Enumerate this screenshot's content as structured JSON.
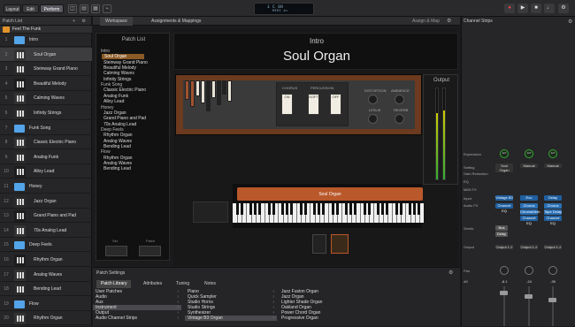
{
  "toolbar": {
    "layout_label": "Layout",
    "edit_label": "Edit",
    "perform_label": "Perform",
    "lcd_line1": "1  C  80",
    "lcd_line2": "MIDI in"
  },
  "left_panel": {
    "title": "Patch List",
    "rows": [
      {
        "num": "",
        "label": "Feel The Funk",
        "type": "set"
      },
      {
        "num": "1",
        "label": "Intro",
        "type": "folder"
      },
      {
        "num": "2",
        "label": "Soul Organ",
        "type": "patch",
        "selected": true
      },
      {
        "num": "3",
        "label": "Steinway Grand Piano",
        "type": "patch"
      },
      {
        "num": "4",
        "label": "Beautiful Melody",
        "type": "patch"
      },
      {
        "num": "5",
        "label": "Calming Waves",
        "type": "patch"
      },
      {
        "num": "6",
        "label": "Infinity Strings",
        "type": "patch"
      },
      {
        "num": "7",
        "label": "Funk Song",
        "type": "folder"
      },
      {
        "num": "8",
        "label": "Classic Electric Piano",
        "type": "patch"
      },
      {
        "num": "9",
        "label": "Analog Funk",
        "type": "patch"
      },
      {
        "num": "10",
        "label": "Alloy Lead",
        "type": "patch"
      },
      {
        "num": "11",
        "label": "Honey",
        "type": "folder"
      },
      {
        "num": "12",
        "label": "Jazz Organ",
        "type": "patch"
      },
      {
        "num": "13",
        "label": "Grand Piano and Pad",
        "type": "patch"
      },
      {
        "num": "14",
        "label": "70s Analog Lead",
        "type": "patch"
      },
      {
        "num": "15",
        "label": "Deep Feels",
        "type": "folder"
      },
      {
        "num": "16",
        "label": "Rhythm Organ",
        "type": "patch"
      },
      {
        "num": "17",
        "label": "Analog Waves",
        "type": "patch"
      },
      {
        "num": "18",
        "label": "Bending Lead",
        "type": "patch"
      },
      {
        "num": "19",
        "label": "Flow",
        "type": "folder"
      },
      {
        "num": "20",
        "label": "Rhythm Organ",
        "type": "patch"
      }
    ]
  },
  "tabs": {
    "workspace": "Workspace",
    "assignments": "Assignments & Mappings",
    "assign_map": "Assign & Map"
  },
  "patch_list_widget": {
    "title": "Patch List",
    "items": [
      {
        "label": "Intro",
        "kind": "head"
      },
      {
        "label": "Soul Organ",
        "kind": "sel"
      },
      {
        "label": "Steinway Grand Piano",
        "kind": "item"
      },
      {
        "label": "Beautiful Melody",
        "kind": "item"
      },
      {
        "label": "Calming Waves",
        "kind": "item"
      },
      {
        "label": "Infinity Strings",
        "kind": "item"
      },
      {
        "label": "Funk Song",
        "kind": "head"
      },
      {
        "label": "Classic Electric Piano",
        "kind": "item"
      },
      {
        "label": "Analog Funk",
        "kind": "item"
      },
      {
        "label": "Alloy Lead",
        "kind": "item"
      },
      {
        "label": "Honey",
        "kind": "head"
      },
      {
        "label": "Jazz Organ",
        "kind": "item"
      },
      {
        "label": "Grand Piano and Pad",
        "kind": "item"
      },
      {
        "label": "70s Analog Lead",
        "kind": "item"
      },
      {
        "label": "Deep Feels",
        "kind": "head"
      },
      {
        "label": "Rhythm Organ",
        "kind": "item"
      },
      {
        "label": "Analog Waves",
        "kind": "item"
      },
      {
        "label": "Bending Lead",
        "kind": "item"
      },
      {
        "label": "Flow",
        "kind": "head"
      },
      {
        "label": "Rhythm Organ",
        "kind": "item"
      },
      {
        "label": "Analog Waves",
        "kind": "item"
      },
      {
        "label": "Bending Lead",
        "kind": "item"
      }
    ],
    "btn_left": "Set",
    "btn_right": "Patch"
  },
  "title_block": {
    "set_name": "Intro",
    "patch_name": "Soul Organ"
  },
  "organ": {
    "chorus": "CHORUS",
    "percussion": "PERCUSSION",
    "distortion": "DISTORTION",
    "ambience": "AMBIENCE",
    "leslie": "LESLIE",
    "reverb": "REVERB",
    "on": "ON",
    "soft": "SOFT",
    "off": "OFF"
  },
  "output": {
    "label": "Output"
  },
  "keyboard": {
    "label": "Soul Organ"
  },
  "patch_settings": {
    "title": "Patch Settings",
    "tabs": [
      "Patch Library",
      "Attributes",
      "Tuning",
      "Notes"
    ],
    "col1": [
      "User Patches",
      "Audio",
      "Aux",
      "Instrument",
      "Output",
      "Audio Channel Strips"
    ],
    "col1_selected": "Instrument",
    "col2": [
      "Piano",
      "Quick Sampler",
      "Studio Horns",
      "Studio Strings",
      "Synthesizer",
      "Vintage B3 Organ"
    ],
    "col2_selected": "Vintage B3 Organ",
    "col3": [
      "Jazz Fusion Organ",
      "Jazz Organ",
      "Lighter Shade Organ",
      "Oakland Organ",
      "Power Chord Organ",
      "Progressive Organ"
    ]
  },
  "channel_strips": {
    "title": "Channel Strips",
    "row_labels": {
      "expression": "Expression",
      "setting": "Setting",
      "gain_reduction": "Gain Reduction",
      "eq": "EQ",
      "midi_fx": "MIDI FX",
      "input": "Input",
      "audio_fx": "Audio FX",
      "sends": "Sends",
      "output": "Output",
      "pan": "Pan",
      "db": "dB"
    },
    "strips": [
      {
        "expr": "127",
        "setting": "Soul Organ",
        "input": "Vintage B3",
        "fx": [
          "Channel EQ"
        ],
        "sends": [
          "Bus",
          "Delay"
        ],
        "output": "Output 1-2",
        "db": "-8.1"
      },
      {
        "expr": "127",
        "setting": "Manual",
        "input": "Evo",
        "fx": [
          "Chorus",
          "ChromaVerb",
          "Channel EQ"
        ],
        "sends": [],
        "output": "Output 1-2",
        "db": "-24"
      },
      {
        "expr": "127",
        "setting": "Manual",
        "input": "Delay",
        "fx": [
          "Chorus",
          "Tape Delay",
          "Channel EQ"
        ],
        "sends": [],
        "output": "Output 1-2",
        "db": "-39"
      }
    ]
  }
}
